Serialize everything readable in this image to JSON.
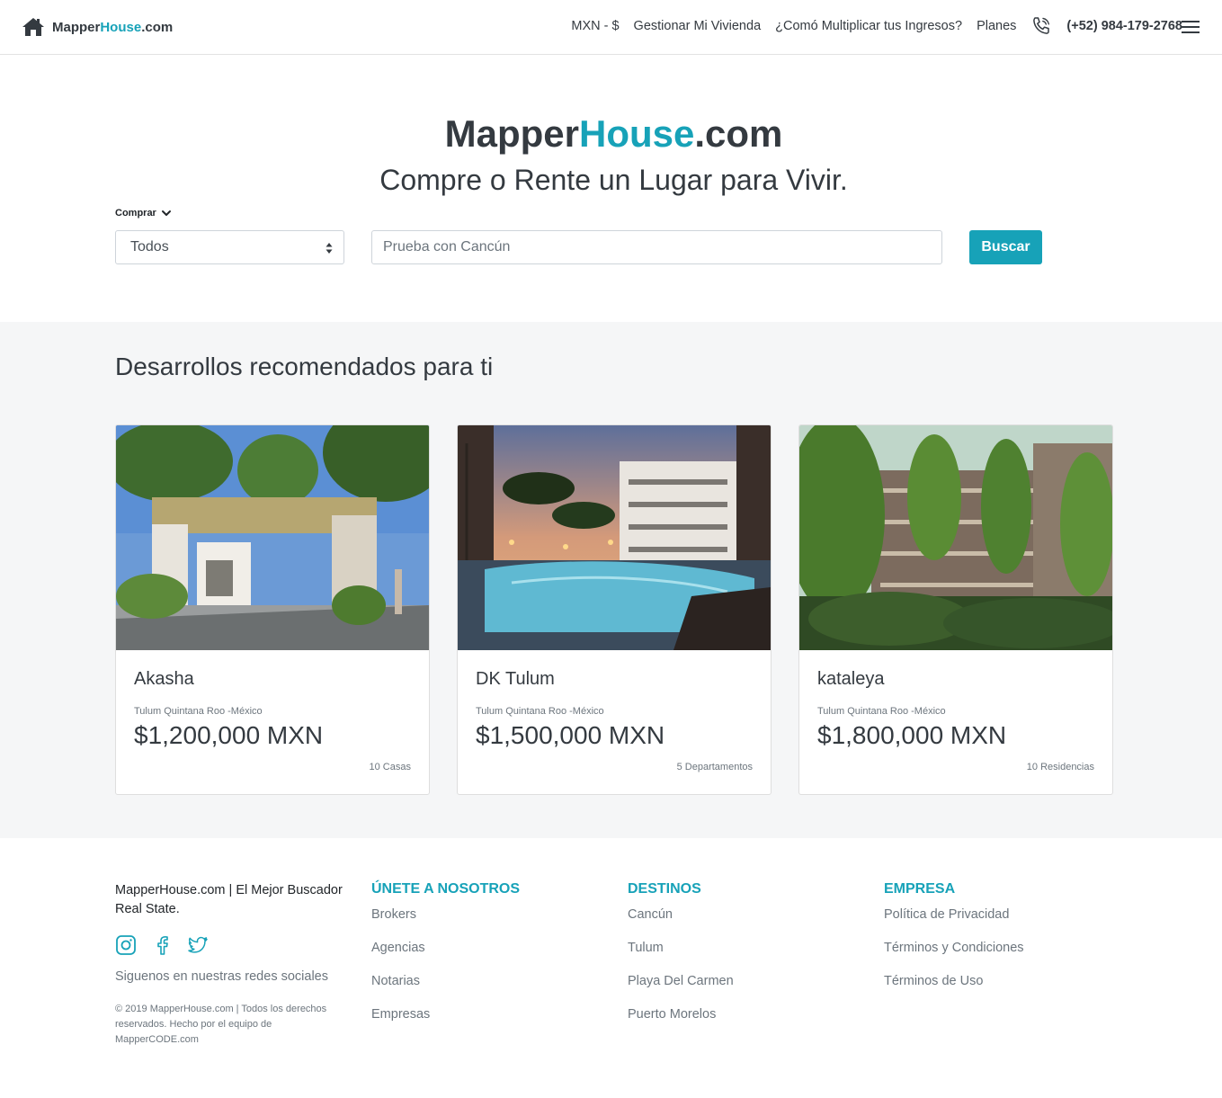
{
  "brand": {
    "name_part1": "Mapper",
    "name_part2": "House",
    "name_part3": ".com",
    "accent_color": "#17a2b8"
  },
  "nav": {
    "currency": "MXN - $",
    "manage": "Gestionar Mi Vivienda",
    "income": "¿Comó Multiplicar tus Ingresos?",
    "plans": "Planes",
    "phone": "(+52) 984-179-2768",
    "icons": [
      "home-icon",
      "phone-icon",
      "menu-icon"
    ]
  },
  "hero": {
    "title_part1": "Mapper",
    "title_part2": "House",
    "title_part3": ".com",
    "subtitle": "Compre o Rente un Lugar para Vivir.",
    "mode_label": "Comprar",
    "type_value": "Todos",
    "search_placeholder": "Prueba con Cancún",
    "search_button": "Buscar"
  },
  "recommended": {
    "title": "Desarrollos recomendados para ti",
    "cards": [
      {
        "name": "Akasha",
        "location": "Tulum Quintana Roo -México",
        "price": "$1,200,000 MXN",
        "units": "10 Casas"
      },
      {
        "name": "DK Tulum",
        "location": "Tulum Quintana Roo -México",
        "price": "$1,500,000 MXN",
        "units": "5 Departamentos"
      },
      {
        "name": "kataleya",
        "location": "Tulum Quintana Roo -México",
        "price": "$1,800,000 MXN",
        "units": "10 Residencias"
      }
    ]
  },
  "footer": {
    "tagline": "MapperHouse.com | El Mejor Buscador Real State.",
    "follow": "Siguenos en nuestras redes sociales",
    "copyright": "© 2019 MapperHouse.com | Todos los derechos reservados. Hecho por el equipo de MapperCODE.com",
    "social_icons": [
      "instagram-icon",
      "facebook-icon",
      "twitter-icon"
    ],
    "join": {
      "heading": "ÚNETE A NOSOTROS",
      "links": [
        "Brokers",
        "Agencias",
        "Notarias",
        "Empresas"
      ]
    },
    "destinations": {
      "heading": "DESTINOS",
      "links": [
        "Cancún",
        "Tulum",
        "Playa Del Carmen",
        "Puerto Morelos"
      ]
    },
    "company": {
      "heading": "EMPRESA",
      "links": [
        "Política de Privacidad",
        "Términos y Condiciones",
        "Términos de Uso"
      ]
    }
  }
}
